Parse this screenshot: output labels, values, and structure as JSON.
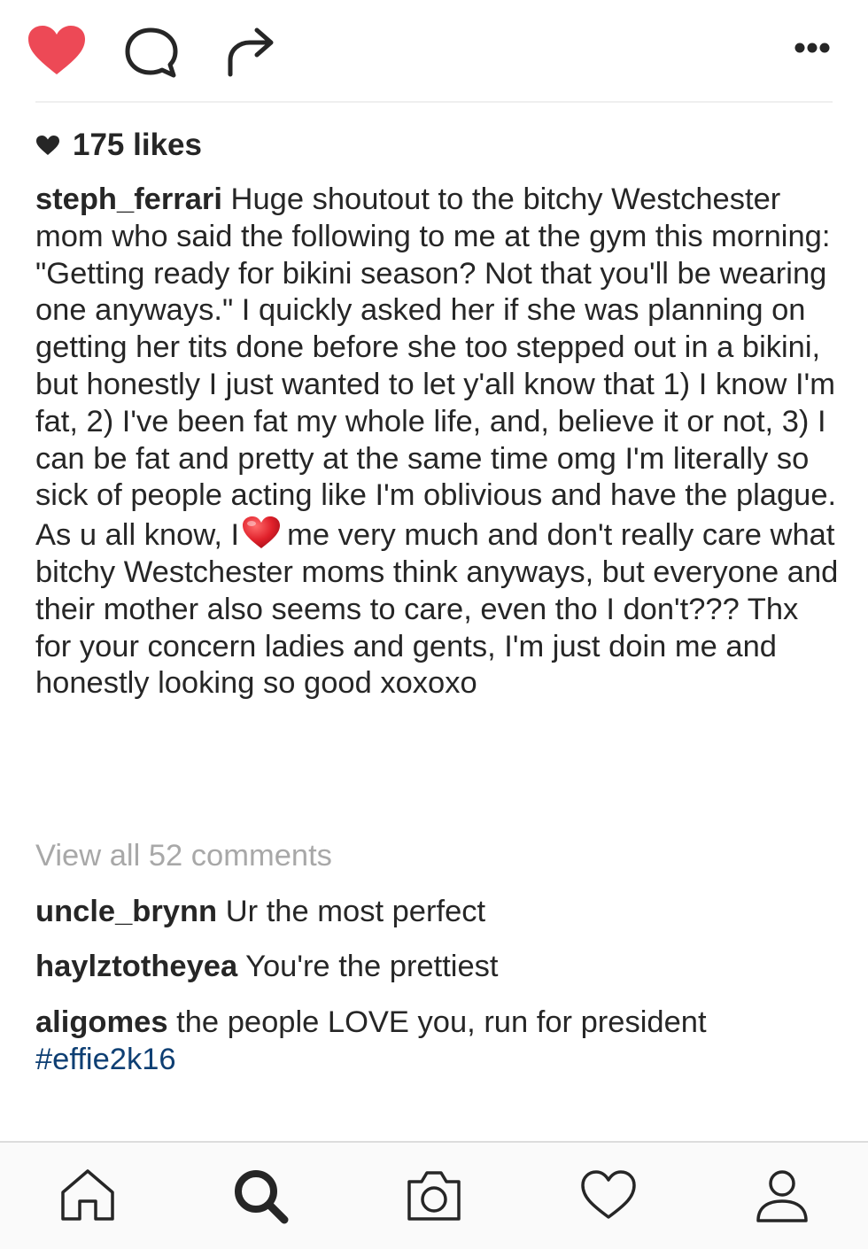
{
  "action_bar": {
    "like_icon": "heart-filled-icon",
    "comment_icon": "comment-bubble-icon",
    "share_icon": "share-arrow-icon",
    "more_icon": "more-dots-icon",
    "like_color": "#ed4956"
  },
  "likes": {
    "icon": "heart-small-icon",
    "text": "175 likes"
  },
  "caption": {
    "username": "steph_ferrari",
    "text_before_emoji": "Huge shoutout to the bitchy Westchester mom who said the following to me at the gym this morning: \"Getting ready for bikini season? Not that you'll be wearing one anyways.\" I quickly asked her if she was planning on getting her tits done before she too stepped out in a bikini, but honestly I just wanted to let y'all know that 1) I know I'm fat, 2) I've been fat my whole life, and, believe it or not, 3) I can be fat and pretty at the same time omg I'm literally so sick of people acting like I'm oblivious and have the plague. As u all know, I",
    "emoji": "red-heart-emoji",
    "text_after_emoji": "me very much and don't really care what bitchy Westchester moms think anyways, but everyone and their mother also seems to care, even tho I don't??? Thx for your concern ladies and gents, I'm just doin me and honestly looking so good xoxoxo"
  },
  "comments_link": "View all 52 comments",
  "comments": [
    {
      "username": "uncle_brynn",
      "text": "Ur the most perfect"
    },
    {
      "username": "haylztotheyea",
      "text": "You're the prettiest"
    },
    {
      "username": "aligomes",
      "text": "the people LOVE you, run for president",
      "hashtag": "#effie2k16"
    }
  ],
  "bottom_nav": {
    "items": [
      "home-icon",
      "search-icon",
      "camera-icon",
      "activity-heart-icon",
      "profile-icon"
    ],
    "active": "search-icon"
  },
  "colors": {
    "text": "#262626",
    "muted": "#a8a8a8",
    "hashtag": "#0e3f73",
    "heart": "#ed4956"
  }
}
